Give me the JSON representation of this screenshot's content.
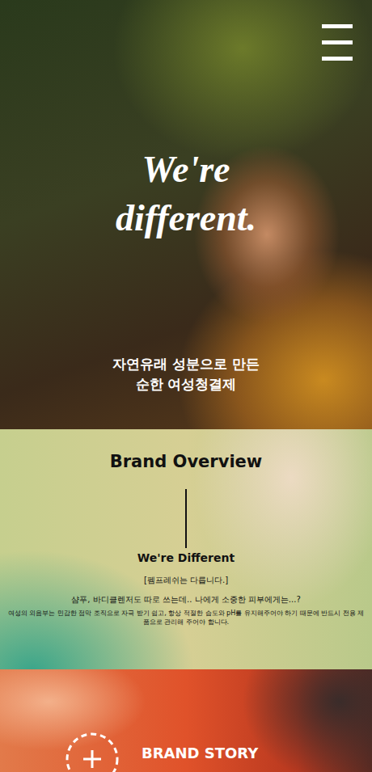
{
  "hero": {
    "title_lines": [
      "We're",
      "different."
    ],
    "subtitle_lines": [
      "자연유래 성분으로 만든",
      "순한 여성청결제"
    ]
  },
  "overview": {
    "title": "Brand Overview",
    "subtitle": "We're Different",
    "tagline": "[펨프레쉬는 다릅니다.]",
    "question": "샴푸, 바디클렌저도 따로 쓰는데.. 나에게 소중한 피부에게는...?",
    "body": "여성의 외음부는 민감한 점막 조직으로 자극 받기 쉽고, 항상 적절한 습도와 pH를 유지해주어야 하기 때문에 반드시 전용 제품으로 관리해 주어야 합니다."
  },
  "story": {
    "label": "BRAND STORY"
  }
}
